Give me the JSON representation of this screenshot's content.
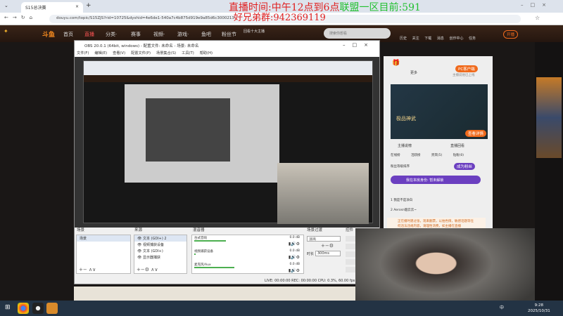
{
  "browser": {
    "tab_title": "S15总决赛",
    "url": "douyu.com/topic/S15ZJS?rid=10725&dyshid=4e6de1-540a7c4b875d919e9a85d6c3000213",
    "new_tab": "+"
  },
  "overlay": {
    "line1_red": "直播时间:中午12点到6点",
    "line1_green": "联盟一区目前:591",
    "line2": "好兄弟群:942369119"
  },
  "site_nav": {
    "logo": "斗鱼",
    "items": [
      "首页",
      "直播",
      "分类·",
      "赛事",
      "视频·",
      "游戏·",
      "鱼吧",
      "粉丝节"
    ],
    "promo": "回看十大主播",
    "search_placeholder": "搜索你想看",
    "icons": [
      "历史",
      "关注",
      "下载",
      "消息",
      "创作中心",
      "任务"
    ],
    "open_live": "开播"
  },
  "obs": {
    "title": "OBS 20.0.1 (64bit, windows) - 配置文件: 未命名 - 场景: 未命名",
    "menu": [
      "文件(F)",
      "编辑(E)",
      "查看(V)",
      "配置文件(P)",
      "场景集合(S)",
      "工具(T)",
      "帮助(H)"
    ],
    "docks": {
      "scenes": {
        "header": "场景",
        "items": [
          "场景"
        ]
      },
      "sources": {
        "header": "来源",
        "items": [
          "文本 (GDI+) 2",
          "视频捕获设备",
          "文本 (GDI+)",
          "显示器捕获"
        ]
      },
      "mixer": {
        "header": "混音器",
        "channels": [
          {
            "name": "台式音响",
            "db": "0.0 dB"
          },
          {
            "name": "视频捕获设备",
            "db": "0.0 dB"
          },
          {
            "name": "麦克风/Aux",
            "db": "0.0 dB"
          }
        ]
      },
      "transitions": {
        "header": "场景过渡",
        "type": "淡出",
        "duration_label": "时长",
        "duration": "300ms"
      },
      "controls": {
        "header": "控件"
      }
    },
    "status": {
      "live": "LIVE: 00:00:00",
      "rec": "REC: 00:00:00",
      "cpu": "CPU: 0.3%, 60.00 fps"
    }
  },
  "sidebar": {
    "more": "更多",
    "pc_client": "PC客户端",
    "pc_sub": "主播说他已上线",
    "ad_title": "极品神武",
    "ad_btn": "查看详情",
    "tabs1": [
      "主播说榜",
      "直播回看"
    ],
    "tabs2": [
      "在线榜",
      "活跃榜",
      "贵宾(5)",
      "钻粉(0)"
    ],
    "fan_label": "粉丝等级排序",
    "fan_btn": "成为粉丝",
    "identity": "我在本房身份: 暂未解锁",
    "rank": [
      {
        "n": "1",
        "name": "我是不是净白"
      },
      {
        "n": "2",
        "name": "Aerosn烟云云~"
      }
    ],
    "notice": "正在播时建过张，现来翻票，以拍色情，敏感话题等任何违法违规内容，请理性消费，如主播在直播"
  },
  "taskbar": {
    "time": "9:28",
    "date": "2025/10/31",
    "ime": "中"
  }
}
